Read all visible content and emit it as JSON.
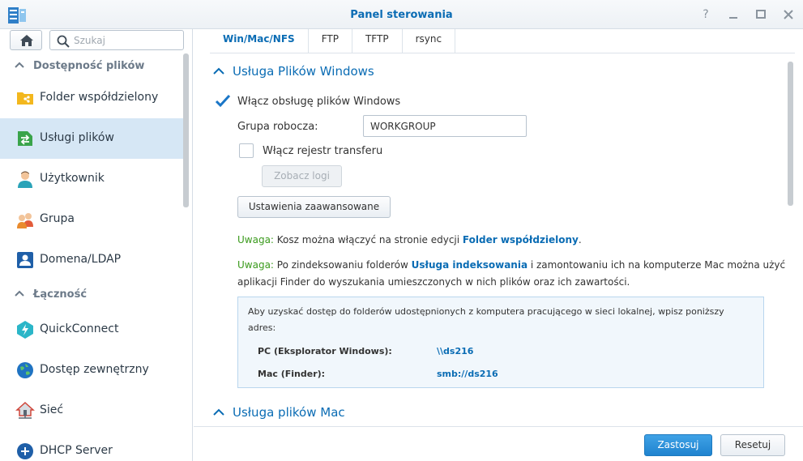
{
  "window": {
    "title": "Panel sterowania"
  },
  "sidebar": {
    "search_placeholder": "Szukaj",
    "sections": [
      {
        "label": "Dostępność plików",
        "items": [
          {
            "label": "Folder współdzielony",
            "icon": "shared-folder-icon"
          },
          {
            "label": "Usługi plików",
            "icon": "file-services-icon",
            "active": true
          },
          {
            "label": "Użytkownik",
            "icon": "user-icon"
          },
          {
            "label": "Grupa",
            "icon": "group-icon"
          },
          {
            "label": "Domena/LDAP",
            "icon": "domain-ldap-icon"
          }
        ]
      },
      {
        "label": "Łączność",
        "items": [
          {
            "label": "QuickConnect",
            "icon": "quickconnect-icon"
          },
          {
            "label": "Dostęp zewnętrzny",
            "icon": "external-access-icon"
          },
          {
            "label": "Sieć",
            "icon": "network-icon"
          },
          {
            "label": "DHCP Server",
            "icon": "dhcp-server-icon"
          }
        ]
      }
    ]
  },
  "tabs": [
    {
      "label": "Win/Mac/NFS",
      "active": true
    },
    {
      "label": "FTP"
    },
    {
      "label": "TFTP"
    },
    {
      "label": "rsync"
    }
  ],
  "windows_section": {
    "title": "Usługa Plików Windows",
    "enable_label": "Włącz obsługę plików Windows",
    "enable_checked": true,
    "workgroup_label": "Grupa robocza:",
    "workgroup_value": "WORKGROUP",
    "transfer_log_label": "Włącz rejestr transferu",
    "transfer_log_checked": false,
    "view_logs_button": "Zobacz logi",
    "advanced_button": "Ustawienia zaawansowane"
  },
  "notes": [
    {
      "prefix": "Uwaga:",
      "before": " Kosz można włączyć na stronie edycji ",
      "link": "Folder współdzielony",
      "after": "."
    },
    {
      "prefix": "Uwaga:",
      "before": " Po zindeksowaniu folderów ",
      "link": "Usługa indeksowania",
      "after": " i zamontowaniu ich na komputerze Mac można użyć aplikacji Finder do wyszukania umieszczonych w nich plików oraz ich zawartości."
    }
  ],
  "info_box": {
    "description": "Aby uzyskać dostęp do folderów udostępnionych z komputera pracującego w sieci lokalnej, wpisz poniższy adres:",
    "rows": [
      {
        "key": "PC (Eksplorator Windows):",
        "value": "\\\\ds216"
      },
      {
        "key": "Mac (Finder):",
        "value": "smb://ds216"
      }
    ]
  },
  "mac_section": {
    "title": "Usługa plików Mac"
  },
  "footer": {
    "apply_button": "Zastosuj",
    "reset_button": "Resetuj"
  },
  "colors": {
    "accent": "#0a6cb4",
    "note_green": "#3a9a1c",
    "active_item_bg": "#d6e7f5",
    "primary_button": "#2a8fd9"
  }
}
